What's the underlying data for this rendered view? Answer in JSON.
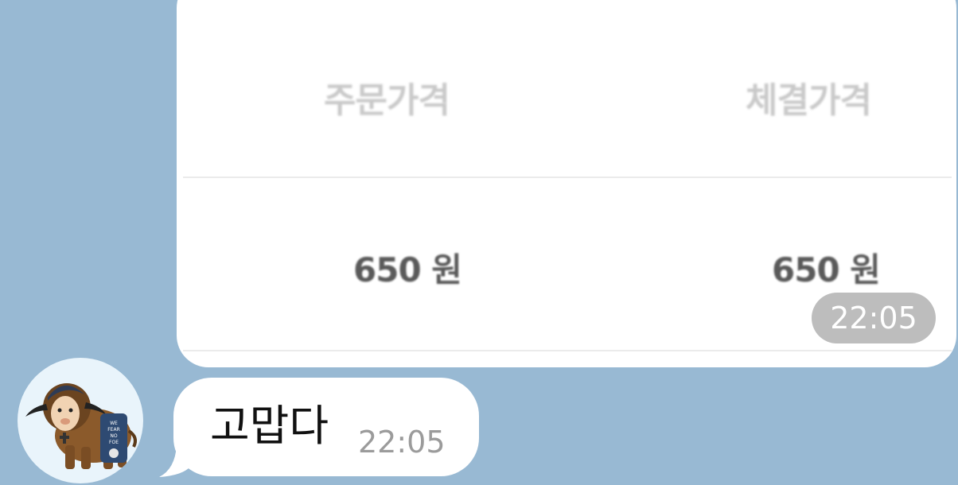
{
  "chat": {
    "messages": [
      {
        "type": "image",
        "content": {
          "header_left": "주문가격",
          "header_right": "체결가격",
          "price_left": "650 원",
          "price_right": "650 원"
        },
        "time": "22:05"
      },
      {
        "type": "text",
        "text": "고맙다",
        "time": "22:05"
      }
    ],
    "avatar": {
      "icon": "bison-mascot-icon",
      "badge_text": "WE FEAR NO FOE"
    }
  },
  "colors": {
    "background": "#98b9d3",
    "bubble": "#ffffff",
    "time_pill": "#bdbdbd"
  }
}
